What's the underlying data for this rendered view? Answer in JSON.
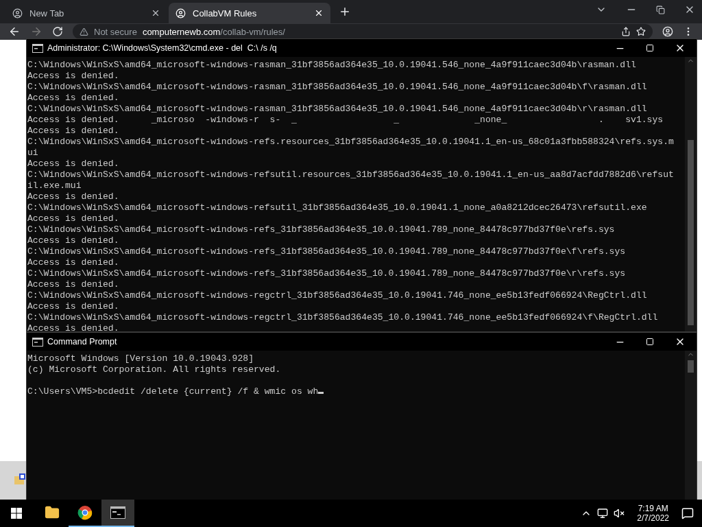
{
  "browser": {
    "tabs": [
      {
        "title": "New Tab",
        "selected": false
      },
      {
        "title": "CollabVM Rules",
        "selected": true
      }
    ],
    "address": {
      "security": "Not secure",
      "host": "computernewb.com",
      "path": "/collab-vm/rules/"
    }
  },
  "windows": [
    {
      "title": "Administrator: C:\\Windows\\System32\\cmd.exe - del  C:\\ /s /q",
      "lines": [
        "C:\\Windows\\WinSxS\\amd64_microsoft-windows-rasman_31bf3856ad364e35_10.0.19041.546_none_4a9f911caec3d04b\\rasman.dll",
        "Access is denied.",
        "C:\\Windows\\WinSxS\\amd64_microsoft-windows-rasman_31bf3856ad364e35_10.0.19041.546_none_4a9f911caec3d04b\\f\\rasman.dll",
        "Access is denied.",
        "C:\\Windows\\WinSxS\\amd64_microsoft-windows-rasman_31bf3856ad364e35_10.0.19041.546_none_4a9f911caec3d04b\\r\\rasman.dll",
        "Access is denied.      _microso  -windows-r  s-  _                  _              _none_                 .    sv1.sys",
        "Access is denied.",
        "C:\\Windows\\WinSxS\\amd64_microsoft-windows-refs.resources_31bf3856ad364e35_10.0.19041.1_en-us_68c01a3fbb588324\\refs.sys.m",
        "ui",
        "Access is denied.",
        "C:\\Windows\\WinSxS\\amd64_microsoft-windows-refsutil.resources_31bf3856ad364e35_10.0.19041.1_en-us_aa8d7acfdd7882d6\\refsut",
        "il.exe.mui",
        "Access is denied.",
        "C:\\Windows\\WinSxS\\amd64_microsoft-windows-refsutil_31bf3856ad364e35_10.0.19041.1_none_a0a8212dcec26473\\refsutil.exe",
        "Access is denied.",
        "C:\\Windows\\WinSxS\\amd64_microsoft-windows-refs_31bf3856ad364e35_10.0.19041.789_none_84478c977bd37f0e\\refs.sys",
        "Access is denied.",
        "C:\\Windows\\WinSxS\\amd64_microsoft-windows-refs_31bf3856ad364e35_10.0.19041.789_none_84478c977bd37f0e\\f\\refs.sys",
        "Access is denied.",
        "C:\\Windows\\WinSxS\\amd64_microsoft-windows-refs_31bf3856ad364e35_10.0.19041.789_none_84478c977bd37f0e\\r\\refs.sys",
        "Access is denied.",
        "C:\\Windows\\WinSxS\\amd64_microsoft-windows-regctrl_31bf3856ad364e35_10.0.19041.746_none_ee5b13fedf066924\\RegCtrl.dll",
        "Access is denied.",
        "C:\\Windows\\WinSxS\\amd64_microsoft-windows-regctrl_31bf3856ad364e35_10.0.19041.746_none_ee5b13fedf066924\\f\\RegCtrl.dll",
        "Access is denied."
      ]
    },
    {
      "title": "Command Prompt",
      "cursor": true,
      "lines": [
        "Microsoft Windows [Version 10.0.19043.928]",
        "(c) Microsoft Corporation. All rights reserved."
      ],
      "prompt": "C:\\Users\\VM5>bcdedit /delete {current} /f & wmic os wh"
    }
  ],
  "taskbar": {
    "apps": [
      {
        "kind": "explorer",
        "running": false,
        "selected": false
      },
      {
        "kind": "chrome",
        "running": true,
        "selected": false
      },
      {
        "kind": "console",
        "running": true,
        "selected": true
      }
    ],
    "time": "7:19 AM",
    "date": "2/7/2022"
  }
}
